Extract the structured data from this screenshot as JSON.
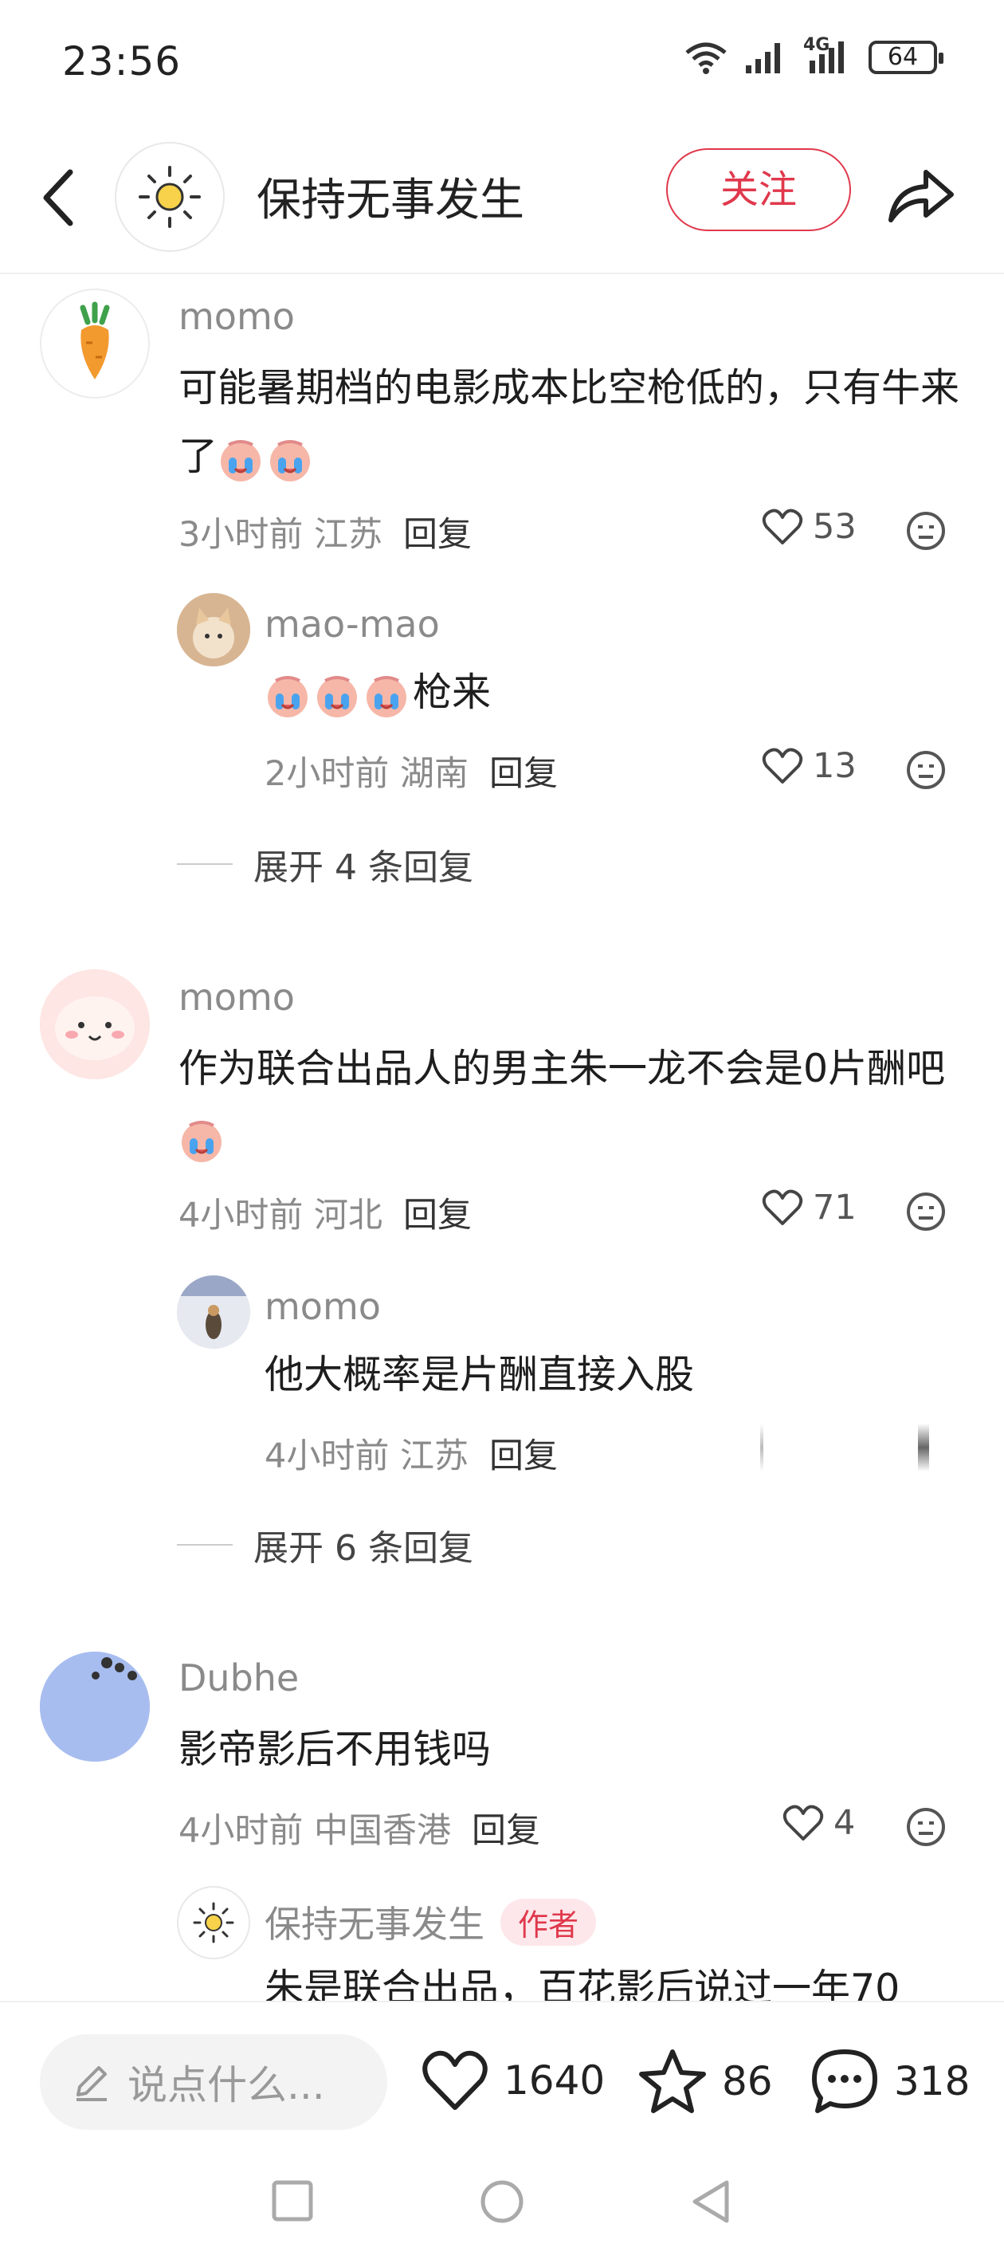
{
  "status": {
    "time": "23:56",
    "battery": "64",
    "network": "4G"
  },
  "header": {
    "title": "保持无事发生",
    "follow_label": "关注"
  },
  "comments": [
    {
      "user": "momo",
      "text": "可能暑期档的电影成本比空枪低的，只有牛来了",
      "time_location": "3小时前 江苏",
      "reply_label": "回复",
      "likes": "53",
      "replies": [
        {
          "user": "mao-mao",
          "text": "枪来",
          "time_location": "2小时前 湖南",
          "reply_label": "回复",
          "likes": "13"
        }
      ],
      "expand_label": "展开 4 条回复"
    },
    {
      "user": "momo",
      "text": "作为联合出品人的男主朱一龙不会是0片酬吧",
      "time_location": "4小时前 河北",
      "reply_label": "回复",
      "likes": "71",
      "replies": [
        {
          "user": "momo",
          "text": "他大概率是片酬直接入股",
          "time_location": "4小时前 江苏",
          "reply_label": "回复"
        }
      ],
      "expand_label": "展开 6 条回复"
    },
    {
      "user": "Dubhe",
      "text": "影帝影后不用钱吗",
      "time_location": "4小时前 中国香港",
      "reply_label": "回复",
      "likes": "4",
      "replies": [
        {
          "user": "保持无事发生",
          "badge": "作者",
          "text": "朱是联合出品，百花影后说过一年70"
        }
      ]
    }
  ],
  "bottom": {
    "input_placeholder": "说点什么...",
    "likes": "1640",
    "stars": "86",
    "comments": "318"
  },
  "colors": {
    "accent": "#e0384c",
    "muted": "#8a8a8a"
  }
}
